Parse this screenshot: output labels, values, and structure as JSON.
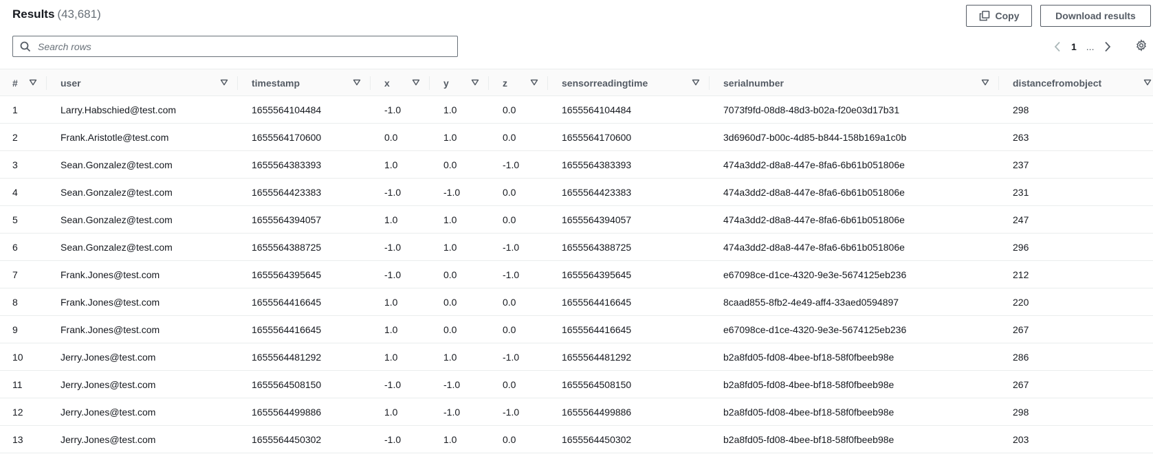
{
  "header": {
    "title": "Results",
    "count": "(43,681)"
  },
  "toolbar": {
    "copy_label": "Copy",
    "download_label": "Download results",
    "copy_icon": "copy-icon"
  },
  "search": {
    "placeholder": "Search rows",
    "value": ""
  },
  "pagination": {
    "current_page": "1",
    "ellipsis": "..."
  },
  "table": {
    "columns": [
      "#",
      "user",
      "timestamp",
      "x",
      "y",
      "z",
      "sensorreadingtime",
      "serialnumber",
      "distancefromobject"
    ],
    "rows": [
      [
        "1",
        "Larry.Habschied@test.com",
        "1655564104484",
        "-1.0",
        "1.0",
        "0.0",
        "1655564104484",
        "7073f9fd-08d8-48d3-b02a-f20e03d17b31",
        "298"
      ],
      [
        "2",
        "Frank.Aristotle@test.com",
        "1655564170600",
        "0.0",
        "1.0",
        "0.0",
        "1655564170600",
        "3d6960d7-b00c-4d85-b844-158b169a1c0b",
        "263"
      ],
      [
        "3",
        "Sean.Gonzalez@test.com",
        "1655564383393",
        "1.0",
        "0.0",
        "-1.0",
        "1655564383393",
        "474a3dd2-d8a8-447e-8fa6-6b61b051806e",
        "237"
      ],
      [
        "4",
        "Sean.Gonzalez@test.com",
        "1655564423383",
        "-1.0",
        "-1.0",
        "0.0",
        "1655564423383",
        "474a3dd2-d8a8-447e-8fa6-6b61b051806e",
        "231"
      ],
      [
        "5",
        "Sean.Gonzalez@test.com",
        "1655564394057",
        "1.0",
        "1.0",
        "0.0",
        "1655564394057",
        "474a3dd2-d8a8-447e-8fa6-6b61b051806e",
        "247"
      ],
      [
        "6",
        "Sean.Gonzalez@test.com",
        "1655564388725",
        "-1.0",
        "1.0",
        "-1.0",
        "1655564388725",
        "474a3dd2-d8a8-447e-8fa6-6b61b051806e",
        "296"
      ],
      [
        "7",
        "Frank.Jones@test.com",
        "1655564395645",
        "-1.0",
        "0.0",
        "-1.0",
        "1655564395645",
        "e67098ce-d1ce-4320-9e3e-5674125eb236",
        "212"
      ],
      [
        "8",
        "Frank.Jones@test.com",
        "1655564416645",
        "1.0",
        "0.0",
        "0.0",
        "1655564416645",
        "8caad855-8fb2-4e49-aff4-33aed0594897",
        "220"
      ],
      [
        "9",
        "Frank.Jones@test.com",
        "1655564416645",
        "1.0",
        "0.0",
        "0.0",
        "1655564416645",
        "e67098ce-d1ce-4320-9e3e-5674125eb236",
        "267"
      ],
      [
        "10",
        "Jerry.Jones@test.com",
        "1655564481292",
        "1.0",
        "1.0",
        "-1.0",
        "1655564481292",
        "b2a8fd05-fd08-4bee-bf18-58f0fbeeb98e",
        "286"
      ],
      [
        "11",
        "Jerry.Jones@test.com",
        "1655564508150",
        "-1.0",
        "-1.0",
        "0.0",
        "1655564508150",
        "b2a8fd05-fd08-4bee-bf18-58f0fbeeb98e",
        "267"
      ],
      [
        "12",
        "Jerry.Jones@test.com",
        "1655564499886",
        "1.0",
        "-1.0",
        "-1.0",
        "1655564499886",
        "b2a8fd05-fd08-4bee-bf18-58f0fbeeb98e",
        "298"
      ],
      [
        "13",
        "Jerry.Jones@test.com",
        "1655564450302",
        "-1.0",
        "1.0",
        "0.0",
        "1655564450302",
        "b2a8fd05-fd08-4bee-bf18-58f0fbeeb98e",
        "203"
      ]
    ]
  }
}
